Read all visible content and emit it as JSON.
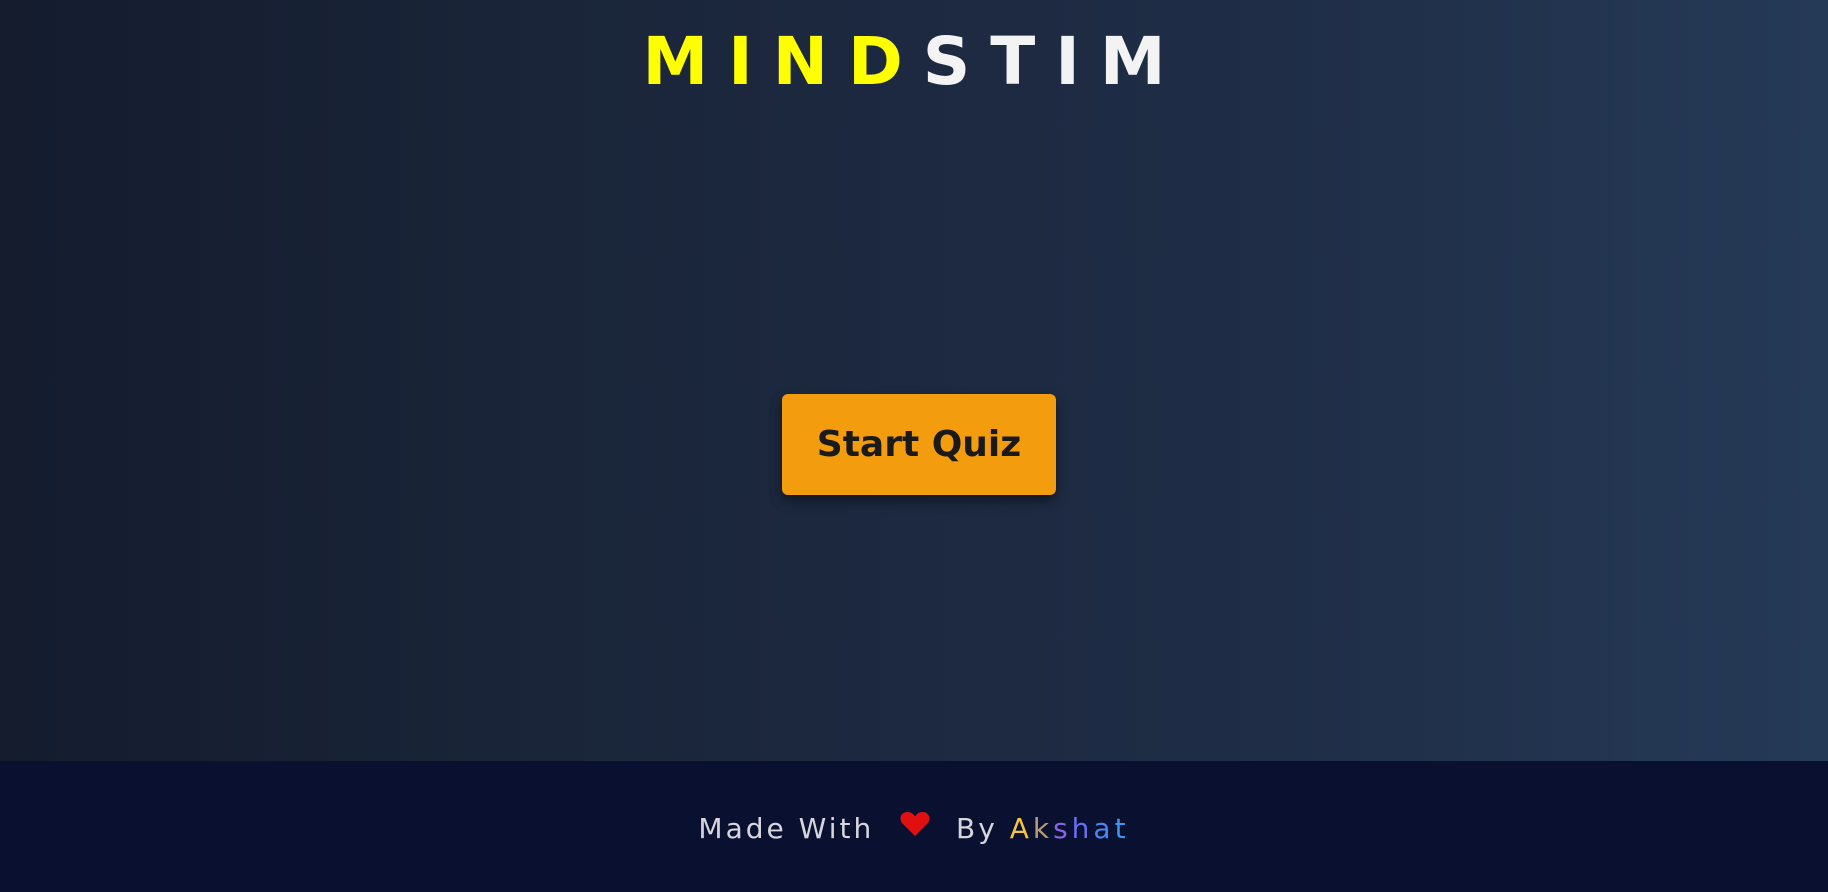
{
  "logo": {
    "part1": "MIND",
    "part2": "STIM",
    "colors": {
      "part1": "#ffff00",
      "part2": "#f3f3f3"
    }
  },
  "main": {
    "start_button_label": "Start Quiz",
    "accent_color": "#f39c0d"
  },
  "footer": {
    "made_with": "Made With",
    "heart_icon": "heart-icon",
    "by": "By",
    "author_letters": [
      "A",
      "k",
      "s",
      "h",
      "a",
      "t"
    ],
    "author": "Akshat"
  }
}
